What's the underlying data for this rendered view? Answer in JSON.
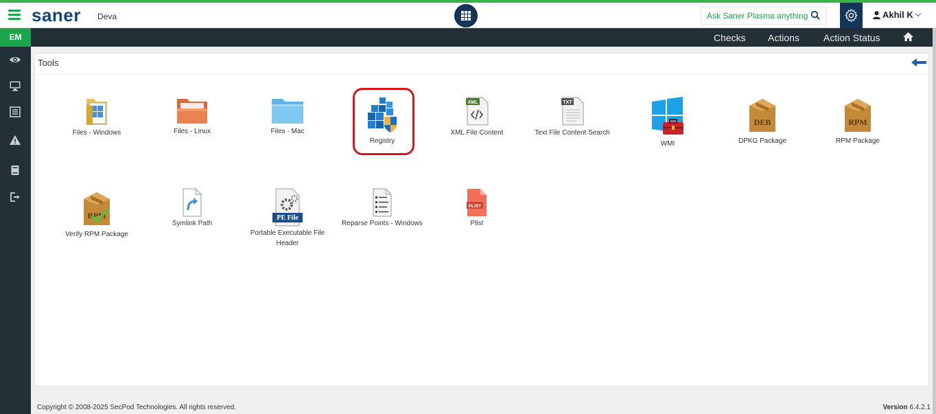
{
  "header": {
    "logo": "saner",
    "organization": "Deva",
    "ask_placeholder": "Ask Saner Plasma anything !",
    "user_name": "Akhil K",
    "accent_color": "#3ab449",
    "brand_color": "#13467e"
  },
  "sidebar": {
    "badge": "EM",
    "icons": [
      "eye-icon",
      "monitor-icon",
      "list-icon",
      "warning-icon",
      "book-icon",
      "logout-icon"
    ]
  },
  "navbar": {
    "items": [
      "Checks",
      "Actions",
      "Action Status"
    ],
    "home_icon": "home-icon"
  },
  "panel": {
    "title": "Tools"
  },
  "tools": [
    {
      "label": "Files - Windows",
      "icon": "windows-folder-icon"
    },
    {
      "label": "Files - Linux",
      "icon": "linux-folder-icon"
    },
    {
      "label": "Files - Mac",
      "icon": "mac-folder-icon"
    },
    {
      "label": "Registry",
      "icon": "registry-icon",
      "highlighted": true
    },
    {
      "label": "XML File Content",
      "icon": "xml-file-icon"
    },
    {
      "label": "Text File Content Search",
      "icon": "txt-file-icon",
      "icon_text": "TXT"
    },
    {
      "label": "WMI",
      "icon": "wmi-icon"
    },
    {
      "label": "DPKG Package",
      "icon": "deb-package-icon",
      "icon_text": "DEB"
    },
    {
      "label": "RPM Package",
      "icon": "rpm-package-icon",
      "icon_text": "RPM"
    },
    {
      "label": "Verify RPM Package",
      "icon": "verify-rpm-icon",
      "icon_text": "RPM"
    },
    {
      "label": "Symlink Path",
      "icon": "symlink-icon"
    },
    {
      "label": "Portable Executable File Header",
      "icon": "pe-file-icon",
      "icon_text": "PE File"
    },
    {
      "label": "Reparse Points - Windows",
      "icon": "reparse-points-icon"
    },
    {
      "label": "Plist",
      "icon": "plist-icon",
      "icon_text": "PLIST"
    }
  ],
  "footer": {
    "copyright": "Copyright © 2008-2025 SecPod Technologies. All rights reserved.",
    "version_label": "Version",
    "version_number": "6.4.2.1"
  }
}
